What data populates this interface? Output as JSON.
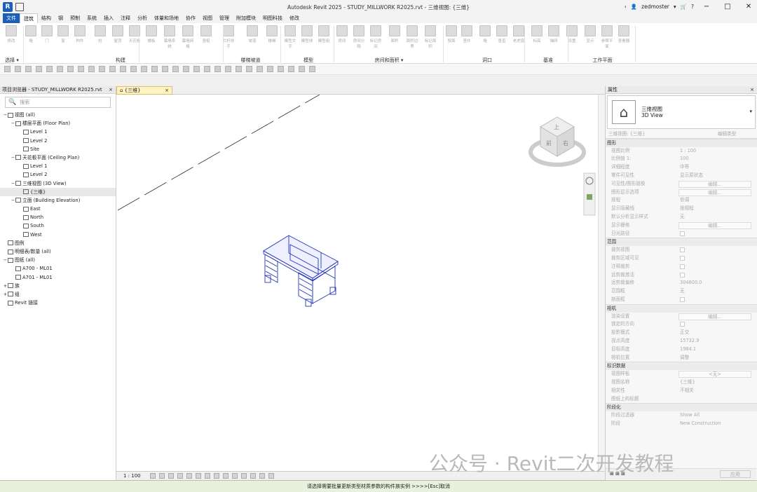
{
  "window": {
    "title": "Autodesk Revit 2025 - STUDY_MILLWORK R2025.rvt - 三维视图: {三维}",
    "user": "zedmoster",
    "logo": "R"
  },
  "menu": [
    "文件",
    "建筑",
    "结构",
    "钢",
    "预制",
    "系统",
    "插入",
    "注释",
    "分析",
    "体量和场地",
    "协作",
    "视图",
    "管理",
    "附加模块",
    "明图科技",
    "修改"
  ],
  "ribbon": {
    "buttons": [
      "修改",
      "墙",
      "门",
      "窗",
      "构件",
      "柱",
      "屋顶",
      "天花板",
      "楼板",
      "幕墙系统",
      "幕墙网格",
      "竖梃",
      "栏杆扶手",
      "坡道",
      "楼梯",
      "模型文字",
      "模型线",
      "模型组",
      "房间",
      "房间分隔",
      "标记房间",
      "面积",
      "面积边界",
      "标记面积",
      "按面",
      "竖井",
      "墙",
      "垂直",
      "老虎窗",
      "标高",
      "轴网",
      "设置",
      "显示",
      "参照平面",
      "查看器"
    ],
    "groups": [
      "选择 ▾",
      "构建",
      "楼梯坡道",
      "模型",
      "房间和面积 ▾",
      "洞口",
      "基准",
      "工作平面"
    ]
  },
  "browser": {
    "title": "项目浏览器 - STUDY_MILLWORK R2025.rvt",
    "close": "×",
    "search_placeholder": "搜索",
    "tree": [
      {
        "t": "−",
        "l": 0,
        "label": "视图 (all)"
      },
      {
        "t": "−",
        "l": 1,
        "label": "楼层平面 (Floor Plan)"
      },
      {
        "t": "",
        "l": 2,
        "label": "Level 1"
      },
      {
        "t": "",
        "l": 2,
        "label": "Level 2"
      },
      {
        "t": "",
        "l": 2,
        "label": "Site"
      },
      {
        "t": "−",
        "l": 1,
        "label": "天花板平面 (Ceiling Plan)"
      },
      {
        "t": "",
        "l": 2,
        "label": "Level 1"
      },
      {
        "t": "",
        "l": 2,
        "label": "Level 2"
      },
      {
        "t": "−",
        "l": 1,
        "label": "三维视图 (3D View)"
      },
      {
        "t": "",
        "l": 2,
        "label": "{三维}",
        "sel": true
      },
      {
        "t": "−",
        "l": 1,
        "label": "立面 (Building Elevation)"
      },
      {
        "t": "",
        "l": 2,
        "label": "East"
      },
      {
        "t": "",
        "l": 2,
        "label": "North"
      },
      {
        "t": "",
        "l": 2,
        "label": "South"
      },
      {
        "t": "",
        "l": 2,
        "label": "West"
      },
      {
        "t": "",
        "l": 0,
        "label": "图例"
      },
      {
        "t": "",
        "l": 0,
        "label": "明细表/数量 (all)"
      },
      {
        "t": "−",
        "l": 0,
        "label": "图纸 (all)"
      },
      {
        "t": "",
        "l": 1,
        "label": "A700 - ML01"
      },
      {
        "t": "",
        "l": 1,
        "label": "A701 - ML01"
      },
      {
        "t": "+",
        "l": 0,
        "label": "族"
      },
      {
        "t": "+",
        "l": 0,
        "label": "组"
      },
      {
        "t": "",
        "l": 0,
        "label": "Revit 链接"
      }
    ]
  },
  "view_tab": {
    "label": "{三维}",
    "close": "×"
  },
  "viewbar": {
    "scale": "1 : 100"
  },
  "viewcube": {
    "face_left": "前",
    "face_right": "右",
    "face_top": "上"
  },
  "props": {
    "title": "属性",
    "close": "×",
    "type_name_1": "三维视图",
    "type_name_2": "3D View",
    "selector": "三维视图: {三维}",
    "edit_type": "编辑类型",
    "rows": [
      {
        "cat": "图形"
      },
      {
        "k": "视图比例",
        "v": "1 : 100"
      },
      {
        "k": "比例值 1:",
        "v": "100"
      },
      {
        "k": "详细程度",
        "v": "中等"
      },
      {
        "k": "零件可见性",
        "v": "显示原状态"
      },
      {
        "k": "可见性/图形替换",
        "btn": "编辑..."
      },
      {
        "k": "图形显示选项",
        "btn": "编辑..."
      },
      {
        "k": "规程",
        "v": "协调"
      },
      {
        "k": "显示隐藏线",
        "v": "按规程"
      },
      {
        "k": "默认分析显示样式",
        "v": "无"
      },
      {
        "k": "显示栅格",
        "btn": "编辑..."
      },
      {
        "k": "日光路径",
        "cb": true
      },
      {
        "cat": "范围"
      },
      {
        "k": "裁剪视图",
        "cb": true
      },
      {
        "k": "裁剪区域可见",
        "cb": true
      },
      {
        "k": "注释裁剪",
        "cb": true
      },
      {
        "k": "远剪裁激活",
        "cb": true
      },
      {
        "k": "远剪裁偏移",
        "v": "304800.0"
      },
      {
        "k": "范围框",
        "v": "无"
      },
      {
        "k": "剖面框",
        "cb": true
      },
      {
        "cat": "相机"
      },
      {
        "k": "渲染设置",
        "btn": "编辑..."
      },
      {
        "k": "锁定的方向",
        "cb": true
      },
      {
        "k": "投影模式",
        "v": "正交"
      },
      {
        "k": "视点高度",
        "v": "15732.9"
      },
      {
        "k": "目标高度",
        "v": "1984.1"
      },
      {
        "k": "相机位置",
        "v": "调整"
      },
      {
        "cat": "标识数据"
      },
      {
        "k": "视图样板",
        "btn": "<无>"
      },
      {
        "k": "视图名称",
        "v": "{三维}"
      },
      {
        "k": "相关性",
        "v": "不相关"
      },
      {
        "k": "图纸上的标题",
        "v": ""
      },
      {
        "cat": "阶段化"
      },
      {
        "k": "阶段过滤器",
        "v": "Show All"
      },
      {
        "k": "阶段",
        "v": "New Construction"
      }
    ],
    "apply": "应用"
  },
  "status": "请选择需要批量更新类型材质参数的构件族实例 >>>>[Esc]取消",
  "watermark": "公众号 · Revit二次开发教程"
}
